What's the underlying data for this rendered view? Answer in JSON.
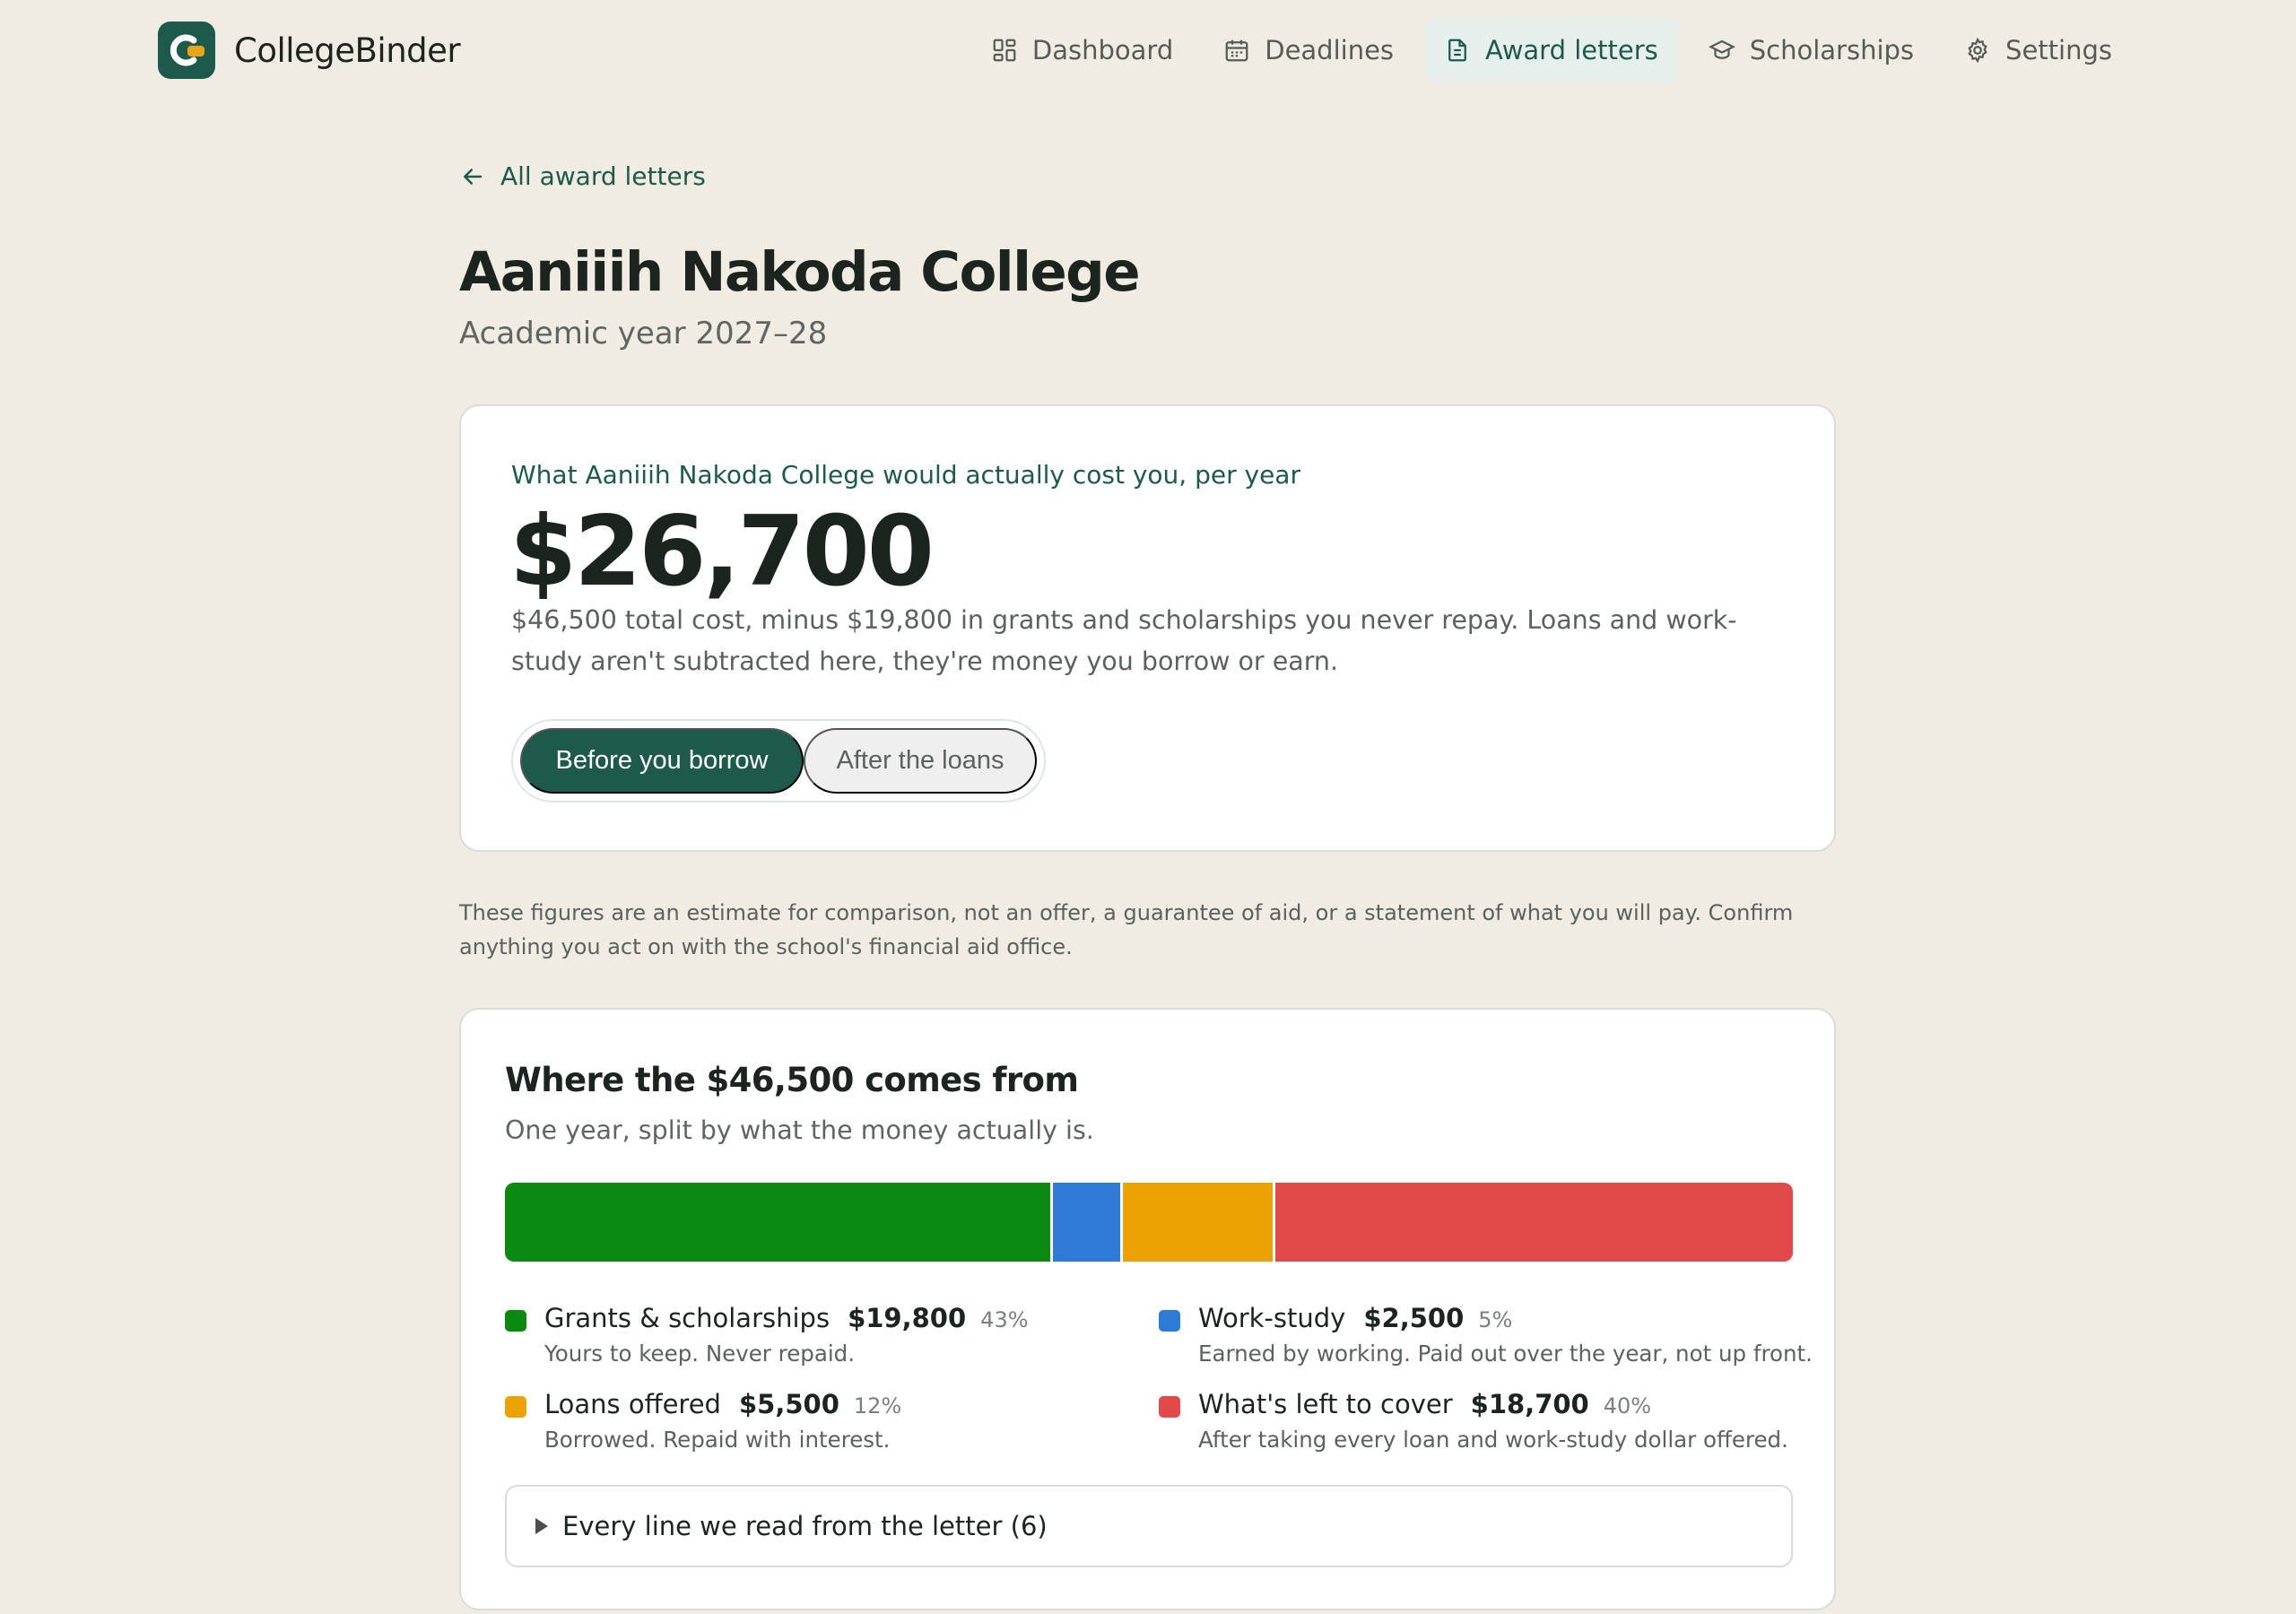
{
  "app": {
    "name": "CollegeBinder"
  },
  "nav": {
    "items": [
      {
        "label": "Dashboard",
        "icon": "dashboard-icon",
        "active": false
      },
      {
        "label": "Deadlines",
        "icon": "calendar-icon",
        "active": false
      },
      {
        "label": "Award letters",
        "icon": "document-icon",
        "active": true
      },
      {
        "label": "Scholarships",
        "icon": "graduation-cap-icon",
        "active": false
      },
      {
        "label": "Settings",
        "icon": "gear-icon",
        "active": false
      }
    ]
  },
  "back_link": {
    "label": "All award letters"
  },
  "page": {
    "title": "Aaniiih Nakoda College",
    "subtitle": "Academic year 2027–28"
  },
  "cost_card": {
    "eyebrow": "What Aaniiih Nakoda College would actually cost you, per year",
    "amount": "$26,700",
    "description": "$46,500 total cost, minus $19,800 in grants and scholarships you never repay. Loans and work-study aren't subtracted here, they're money you borrow or earn.",
    "toggle": {
      "options": [
        "Before you borrow",
        "After the loans"
      ],
      "selected": "Before you borrow"
    }
  },
  "disclaimer": "These figures are an estimate for comparison, not an offer, a guarantee of aid, or a statement of what you will pay. Confirm anything you act on with the school's financial aid office.",
  "breakdown": {
    "title": "Where the $46,500 comes from",
    "subtitle": "One year, split by what the money actually is.",
    "total": 46500,
    "segments": [
      {
        "label": "Grants & scholarships",
        "amount_text": "$19,800",
        "value": 19800,
        "pct": "43%",
        "desc": "Yours to keep. Never repaid.",
        "color": "#0a8a10"
      },
      {
        "label": "Work-study",
        "amount_text": "$2,500",
        "value": 2500,
        "pct": "5%",
        "desc": "Earned by working. Paid out over the year, not up front.",
        "color": "#2d7bd6"
      },
      {
        "label": "Loans offered",
        "amount_text": "$5,500",
        "value": 5500,
        "pct": "12%",
        "desc": "Borrowed. Repaid with interest.",
        "color": "#eba304"
      },
      {
        "label": "What's left to cover",
        "amount_text": "$18,700",
        "value": 18700,
        "pct": "40%",
        "desc": "After taking every loan and work-study dollar offered.",
        "color": "#e24a4a"
      }
    ],
    "details_label": "Every line we read from the letter (6)"
  },
  "colors": {
    "accent": "#1d5a4b",
    "background": "#f0ece2",
    "logo_accent": "#e9a41a"
  }
}
